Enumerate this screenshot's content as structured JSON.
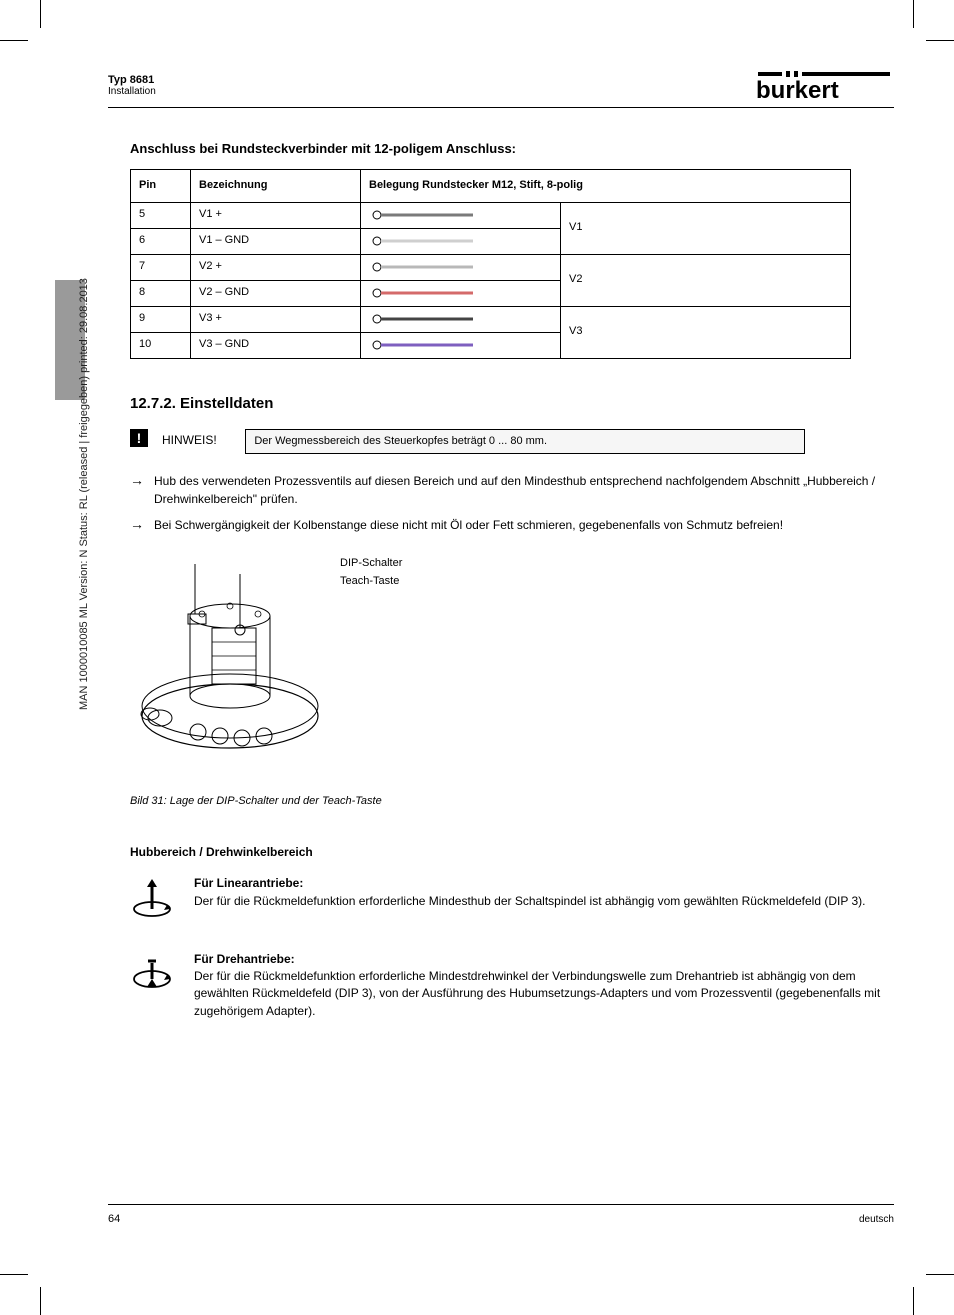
{
  "header": {
    "product_line1": "Typ 8681",
    "product_line2": "Installation",
    "logo_alt": "burkert"
  },
  "section": {
    "title": "Anschluss bei Rundsteckverbinder mit 12-poligem Anschluss:"
  },
  "table": {
    "headers": {
      "pin": "Pin",
      "desig": "Bezeichnung",
      "assign": "Belegung Rundstecker M12, Stift, 8-polig"
    },
    "rows": [
      {
        "pin": "5",
        "desig": "V1 +",
        "wire_color": "#7a7a7a",
        "assign": "V1"
      },
      {
        "pin": "6",
        "desig": "V1 – GND",
        "wire_color": "#cfcfcf",
        "assign": ""
      },
      {
        "pin": "7",
        "desig": "V2 +",
        "wire_color": "#b8b8b8",
        "assign": "V2"
      },
      {
        "pin": "8",
        "desig": "V2 – GND",
        "wire_color": "#d46a6a",
        "assign": ""
      },
      {
        "pin": "9",
        "desig": "V3 +",
        "wire_color": "#444444",
        "assign": "V3"
      },
      {
        "pin": "10",
        "desig": "V3 – GND",
        "wire_color": "#7e5fbf",
        "assign": ""
      }
    ]
  },
  "subsection_title": "12.7.2. Einstelldaten",
  "note": {
    "prefix": "HINWEIS!",
    "box_text": "Der Wegmessbereich des Steuerkopfes beträgt 0 ... 80 mm."
  },
  "arrows": [
    "Hub des verwendeten Prozessventils auf diesen Bereich und auf den Mindesthub entsprechend nachfolgendem Abschnitt „Hubbereich / Drehwinkelbereich\" prüfen.",
    "Bei Schwergängigkeit der Kolbenstange diese nicht mit Öl oder Fett schmieren, gegebenenfalls von Schmutz befreien!"
  ],
  "figure": {
    "labels": [
      "DIP-Schalter",
      "Teach-Taste"
    ],
    "caption": "Bild 31:  Lage der DIP-Schalter und der Teach-Taste"
  },
  "rotary": {
    "heading": "Hubbereich / Drehwinkelbereich",
    "linear": {
      "title": "Für Linearantriebe:",
      "text": "Der für die Rückmeldefunktion erforderliche Mindesthub der Schaltspindel ist abhängig vom gewählten Rückmeldefeld (DIP 3)."
    },
    "rotary_drive": {
      "title": "Für Drehantriebe:",
      "text": "Der für die Rückmeldefunktion erforderliche Mindestdrehwinkel der Verbindungswelle zum Drehantrieb ist abhängig von dem gewählten Rückmeldefeld (DIP 3), von der Ausführung des Hubumsetzungs-Adapters und vom Prozessventil (gegebenenfalls mit zugehörigem Adapter)."
    }
  },
  "footer": {
    "pagenum": "64",
    "text": "deutsch"
  },
  "imprint": "MAN 1000010085 ML Version: N Status: RL (released | freigegeben) printed: 29.08.2013"
}
